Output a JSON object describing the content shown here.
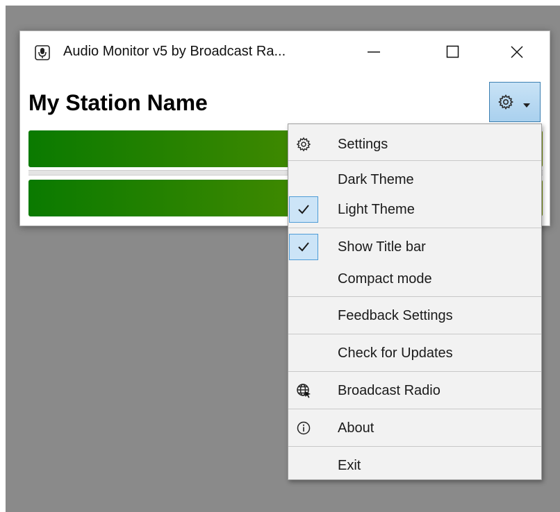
{
  "window": {
    "title": "Audio Monitor v5 by Broadcast Ra...",
    "station_name": "My Station Name",
    "controls": {
      "minimize": "—",
      "maximize": "□",
      "close": "✕"
    }
  },
  "meters": [
    {
      "name": "left-channel",
      "level": 1.0
    },
    {
      "name": "right-channel",
      "level": 1.0
    }
  ],
  "menu": {
    "items": [
      {
        "label": "Settings",
        "icon": "gear-icon"
      },
      {
        "label": "Dark Theme",
        "checked": false
      },
      {
        "label": "Light Theme",
        "checked": true
      },
      {
        "label": "Show Title bar",
        "checked": true
      },
      {
        "label": "Compact mode",
        "checked": false
      },
      {
        "label": "Feedback Settings"
      },
      {
        "label": "Check for Updates"
      },
      {
        "label": "Broadcast Radio",
        "icon": "globe-cursor-icon"
      },
      {
        "label": "About",
        "icon": "info-icon"
      },
      {
        "label": "Exit"
      }
    ]
  },
  "colors": {
    "desktop": "#8a8a8a",
    "meter_start": "#0a7a00",
    "meter_end": "#7a9600",
    "accent_button": "#a9d0ee",
    "check_highlight": "#cce4f7"
  }
}
